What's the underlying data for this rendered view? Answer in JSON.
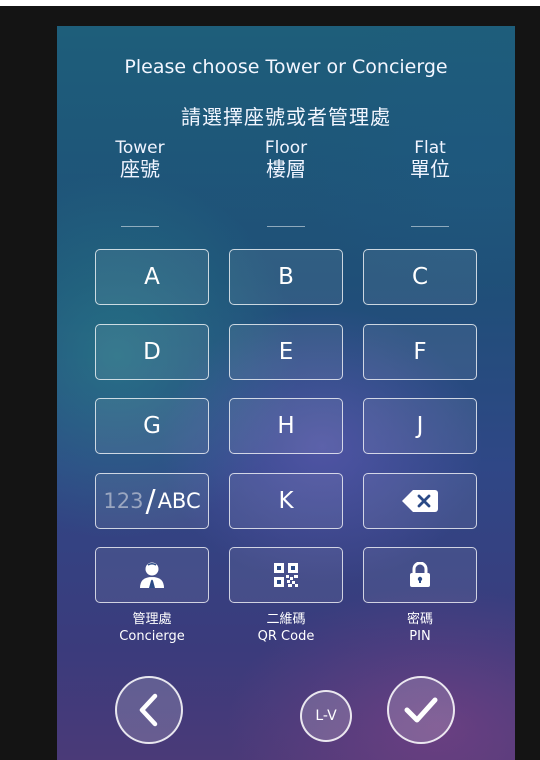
{
  "prompt": {
    "title_en": "Please choose Tower or Concierge",
    "title_zh": "請選擇座號或者管理處"
  },
  "fields": [
    {
      "en": "Tower",
      "zh": "座號"
    },
    {
      "en": "Floor",
      "zh": "樓層"
    },
    {
      "en": "Flat",
      "zh": "單位"
    }
  ],
  "keypad": {
    "letters": [
      "A",
      "B",
      "C",
      "D",
      "E",
      "F",
      "G",
      "H",
      "J",
      "K"
    ],
    "toggle": {
      "numeric": "123",
      "slash": "/",
      "alpha": "ABC"
    },
    "backspace_icon": "backspace-icon"
  },
  "functions": {
    "concierge": {
      "zh": "管理處",
      "en": "Concierge",
      "icon": "concierge-icon"
    },
    "qr_code": {
      "zh": "二維碼",
      "en": "QR Code",
      "icon": "qr-code-icon"
    },
    "pin": {
      "zh": "密碼",
      "en": "PIN",
      "icon": "padlock-icon"
    }
  },
  "bottom": {
    "back_icon": "chevron-left-icon",
    "lv_label": "L-V",
    "confirm_icon": "checkmark-icon"
  }
}
